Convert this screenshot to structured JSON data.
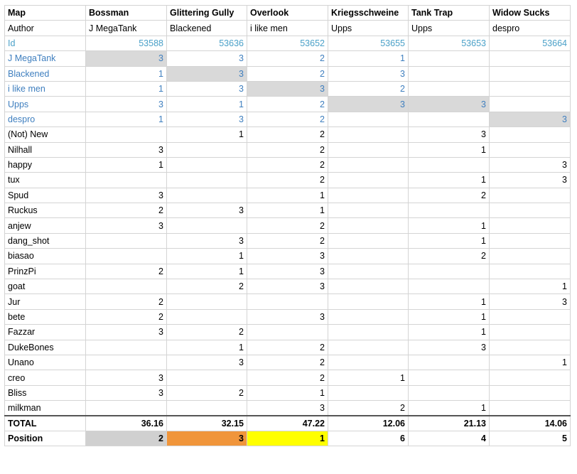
{
  "header": {
    "map_label": "Map",
    "author_label": "Author",
    "id_label": "Id",
    "maps": [
      "Bossman",
      "Glittering Gully",
      "Overlook",
      "Kriegsschweine",
      "Tank Trap",
      "Widow Sucks"
    ],
    "authors": [
      "J MegaTank",
      "Blackened",
      "i like men",
      "Upps",
      "Upps",
      "despro"
    ],
    "ids": [
      "53588",
      "53636",
      "53652",
      "53655",
      "53653",
      "53664"
    ]
  },
  "voters": [
    {
      "name": "J MegaTank",
      "author": true,
      "votes": [
        "3",
        "3",
        "2",
        "1",
        "",
        ""
      ],
      "own": [
        0
      ]
    },
    {
      "name": "Blackened",
      "author": true,
      "votes": [
        "1",
        "3",
        "2",
        "3",
        "",
        ""
      ],
      "own": [
        1
      ]
    },
    {
      "name": "i like men",
      "author": true,
      "votes": [
        "1",
        "3",
        "3",
        "2",
        "",
        ""
      ],
      "own": [
        2
      ]
    },
    {
      "name": "Upps",
      "author": true,
      "votes": [
        "3",
        "1",
        "2",
        "3",
        "3",
        ""
      ],
      "own": [
        3,
        4
      ]
    },
    {
      "name": "despro",
      "author": true,
      "votes": [
        "1",
        "3",
        "2",
        "",
        "",
        "3"
      ],
      "own": [
        5
      ]
    },
    {
      "name": "(Not) New",
      "votes": [
        "",
        "1",
        "2",
        "",
        "3",
        ""
      ]
    },
    {
      "name": "Nilhall",
      "votes": [
        "3",
        "",
        "2",
        "",
        "1",
        ""
      ]
    },
    {
      "name": "happy",
      "votes": [
        "1",
        "",
        "2",
        "",
        "",
        "3"
      ]
    },
    {
      "name": "tux",
      "votes": [
        "",
        "",
        "2",
        "",
        "1",
        "3"
      ]
    },
    {
      "name": "Spud",
      "votes": [
        "3",
        "",
        "1",
        "",
        "2",
        ""
      ]
    },
    {
      "name": "Ruckus",
      "votes": [
        "2",
        "3",
        "1",
        "",
        "",
        ""
      ]
    },
    {
      "name": "anjew",
      "votes": [
        "3",
        "",
        "2",
        "",
        "1",
        ""
      ]
    },
    {
      "name": "dang_shot",
      "votes": [
        "",
        "3",
        "2",
        "",
        "1",
        ""
      ]
    },
    {
      "name": "biasao",
      "votes": [
        "",
        "1",
        "3",
        "",
        "2",
        ""
      ]
    },
    {
      "name": "PrinzPi",
      "votes": [
        "2",
        "1",
        "3",
        "",
        "",
        ""
      ]
    },
    {
      "name": "goat",
      "votes": [
        "",
        "2",
        "3",
        "",
        "",
        "1"
      ]
    },
    {
      "name": "Jur",
      "votes": [
        "2",
        "",
        "",
        "",
        "1",
        "3"
      ]
    },
    {
      "name": "bete",
      "votes": [
        "2",
        "",
        "3",
        "",
        "1",
        ""
      ]
    },
    {
      "name": "Fazzar",
      "votes": [
        "3",
        "2",
        "",
        "",
        "1",
        ""
      ]
    },
    {
      "name": "DukeBones",
      "votes": [
        "",
        "1",
        "2",
        "",
        "3",
        ""
      ]
    },
    {
      "name": "Unano",
      "votes": [
        "",
        "3",
        "2",
        "",
        "",
        "1"
      ]
    },
    {
      "name": "creo",
      "votes": [
        "3",
        "",
        "2",
        "1",
        "",
        ""
      ]
    },
    {
      "name": "Bliss",
      "votes": [
        "3",
        "2",
        "1",
        "",
        "",
        ""
      ]
    },
    {
      "name": "milkman",
      "votes": [
        "",
        "",
        "3",
        "2",
        "1",
        ""
      ]
    }
  ],
  "total": {
    "label": "TOTAL",
    "values": [
      "36.16",
      "32.15",
      "47.22",
      "12.06",
      "21.13",
      "14.06"
    ]
  },
  "position": {
    "label": "Position",
    "values": [
      "2",
      "3",
      "1",
      "6",
      "4",
      "5"
    ],
    "highlight": [
      "grey",
      "orange",
      "yellow",
      "",
      "",
      ""
    ]
  },
  "colors": {
    "author_text": "#3f7fbf",
    "id_text": "#4aa0c8",
    "own_map_cell": "#d9d9d9",
    "first": "#ffff00",
    "second": "#d0d0d0",
    "third": "#f0953b"
  }
}
